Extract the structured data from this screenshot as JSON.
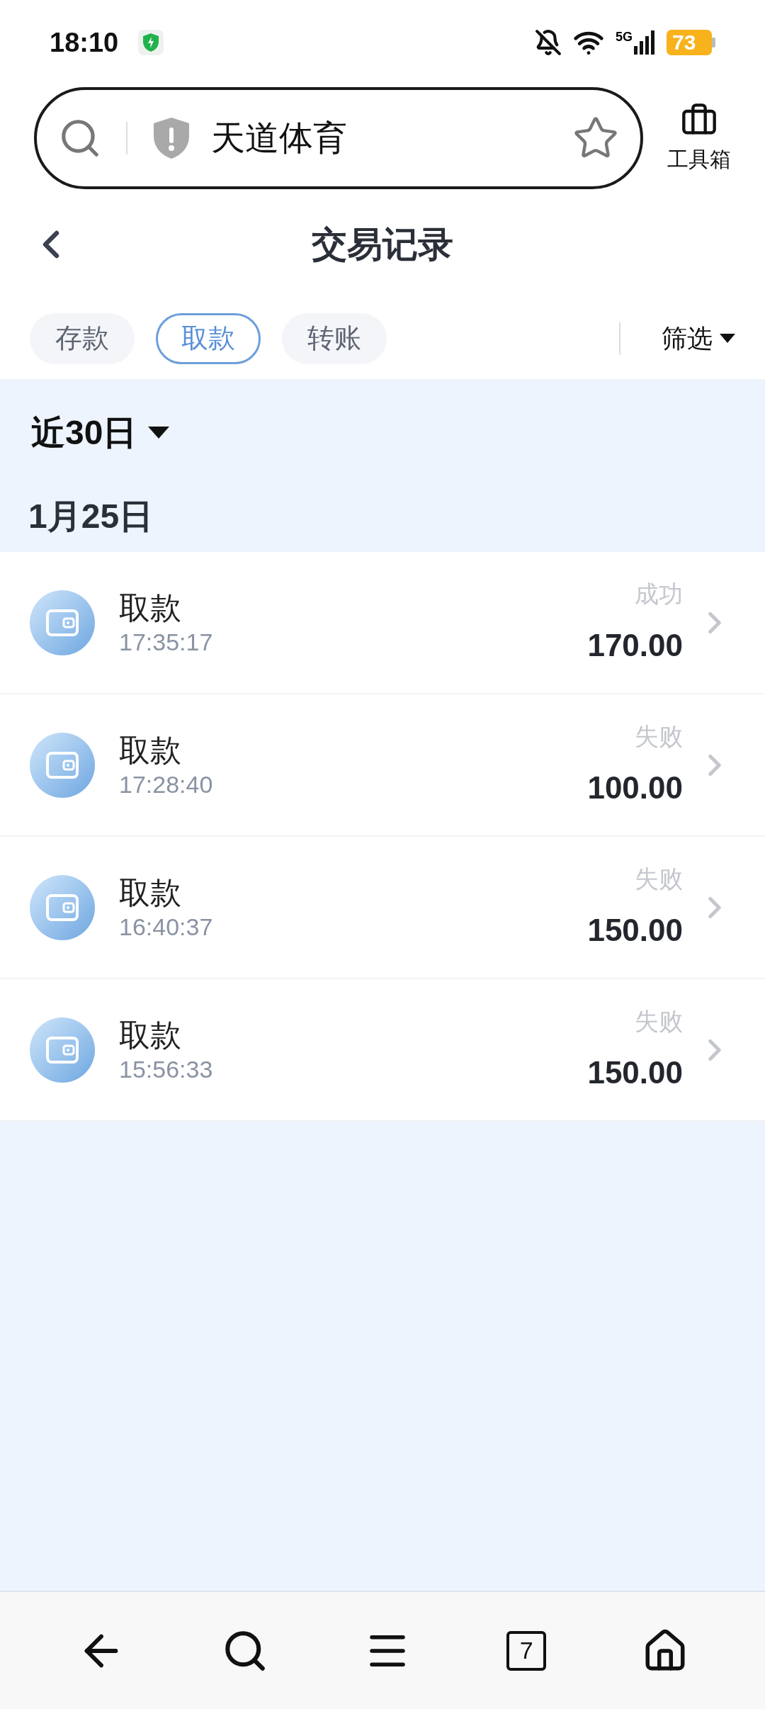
{
  "status_bar": {
    "time": "18:10",
    "network": "5G",
    "battery": "73"
  },
  "address_bar": {
    "value": "天道体育"
  },
  "toolbox": {
    "label": "工具箱"
  },
  "header": {
    "title": "交易记录"
  },
  "tabs": [
    {
      "label": "存款",
      "selected": false
    },
    {
      "label": "取款",
      "selected": true
    },
    {
      "label": "转账",
      "selected": false
    }
  ],
  "filter": {
    "label": "筛选"
  },
  "period": {
    "label": "近30日"
  },
  "date_group": {
    "label": "1月25日"
  },
  "transactions": [
    {
      "title": "取款",
      "time": "17:35:17",
      "status": "成功",
      "amount": "170.00"
    },
    {
      "title": "取款",
      "time": "17:28:40",
      "status": "失败",
      "amount": "100.00"
    },
    {
      "title": "取款",
      "time": "16:40:37",
      "status": "失败",
      "amount": "150.00"
    },
    {
      "title": "取款",
      "time": "15:56:33",
      "status": "失败",
      "amount": "150.00"
    }
  ],
  "bottom_nav": {
    "tab_count": "7"
  }
}
